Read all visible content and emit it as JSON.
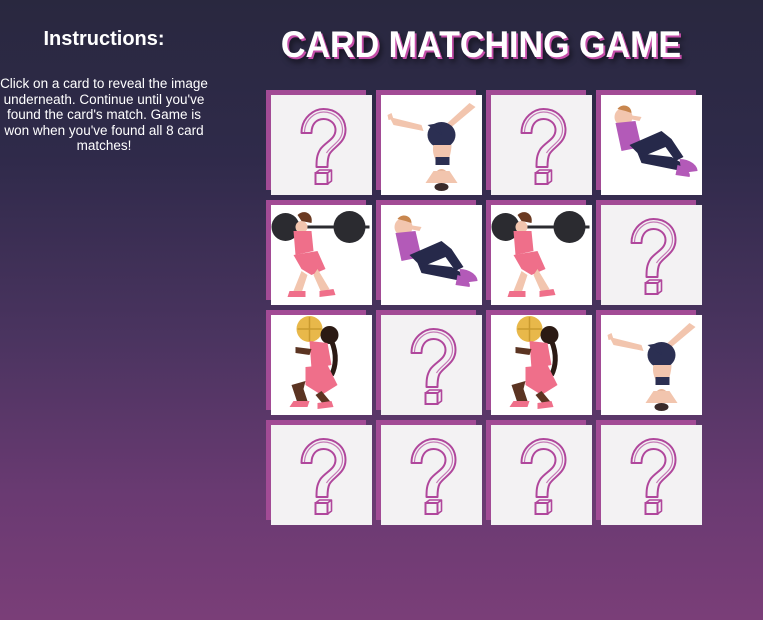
{
  "instructions": {
    "heading": "Instructions:",
    "text": "Click on a card to reveal the image underneath. Continue until you've found the card's match. Game is won when you've found all 8 card matches!"
  },
  "title": "CARD MATCHING GAME",
  "colors": {
    "card_border": "#a24b95",
    "question_mark": "#b0479c",
    "card_face": "#f3f2f3",
    "title_shadow": "#c44ea8"
  },
  "board": {
    "rows": [
      [
        "hidden",
        "headstand",
        "hidden",
        "situp"
      ],
      [
        "barbell-squat",
        "situp",
        "barbell-squat",
        "hidden"
      ],
      [
        "ball-squat",
        "hidden",
        "ball-squat",
        "headstand"
      ],
      [
        "hidden",
        "hidden",
        "hidden",
        "hidden"
      ]
    ]
  }
}
